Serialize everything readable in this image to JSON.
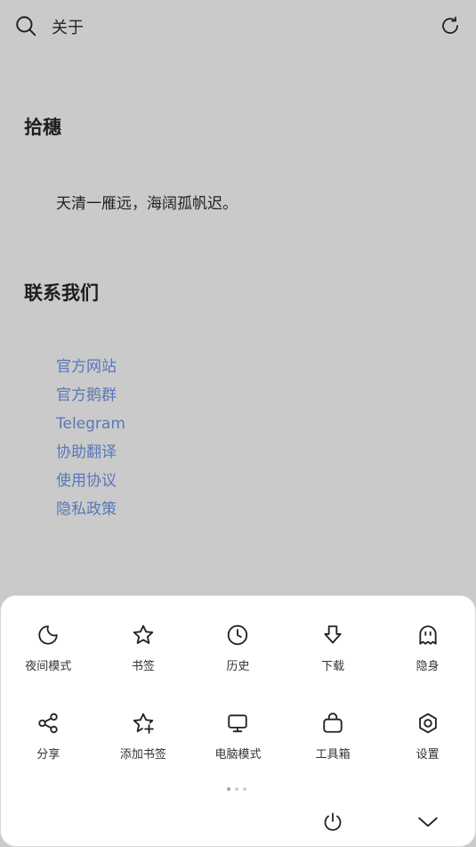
{
  "header": {
    "title": "关于",
    "search_icon": "search-icon",
    "refresh_icon": "refresh-icon"
  },
  "content": {
    "section1_title": "拾穗",
    "poem": "天清一雁远，海阔孤帆迟。",
    "section2_title": "联系我们",
    "links": [
      "官方网站",
      "官方鹅群",
      "Telegram",
      "协助翻译",
      "使用协议",
      "隐私政策"
    ],
    "link_color": "#5a77b8"
  },
  "menu": {
    "items": [
      {
        "label": "夜间模式",
        "icon": "moon-icon"
      },
      {
        "label": "书签",
        "icon": "star-icon"
      },
      {
        "label": "历史",
        "icon": "clock-icon"
      },
      {
        "label": "下载",
        "icon": "download-icon"
      },
      {
        "label": "隐身",
        "icon": "ghost-icon"
      },
      {
        "label": "分享",
        "icon": "share-icon"
      },
      {
        "label": "添加书签",
        "icon": "star-plus-icon"
      },
      {
        "label": "电脑模式",
        "icon": "monitor-icon"
      },
      {
        "label": "工具箱",
        "icon": "toolbox-icon"
      },
      {
        "label": "设置",
        "icon": "settings-icon"
      }
    ],
    "page_indicator": {
      "pages": 3,
      "current": 1
    },
    "power_icon": "power-icon",
    "collapse_icon": "chevron-down-icon"
  }
}
